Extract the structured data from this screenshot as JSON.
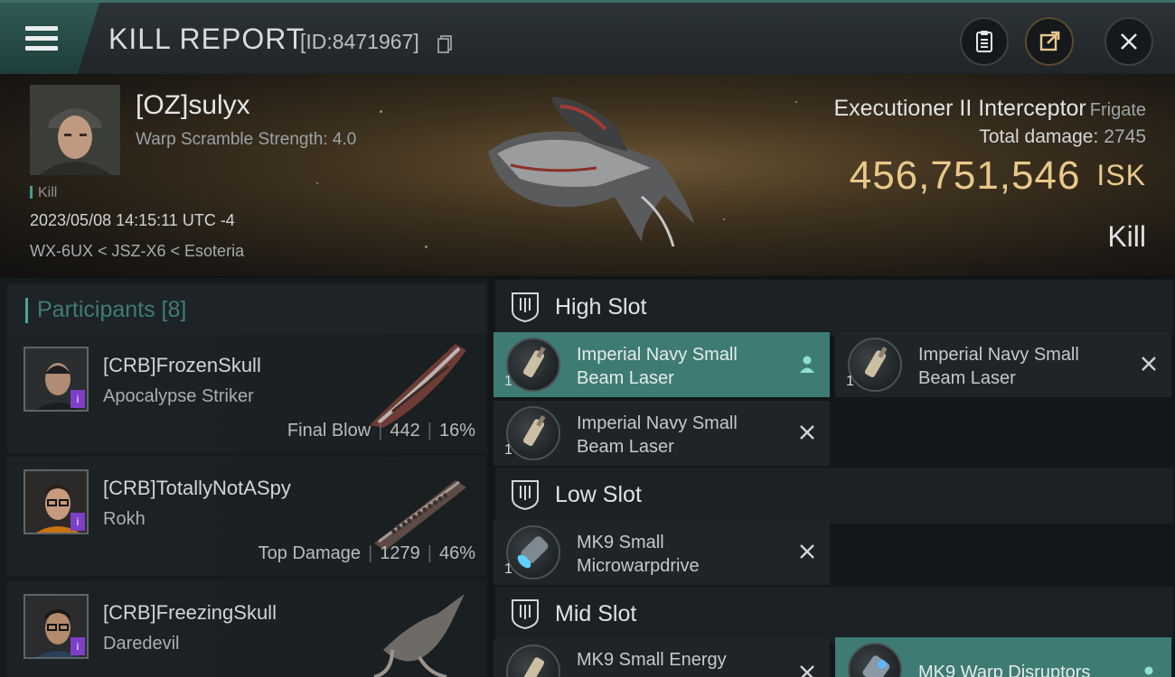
{
  "header": {
    "title": "KILL REPORT",
    "report_id": "[ID:8471967]"
  },
  "victim": {
    "name": "[OZ]sulyx",
    "subtitle": "Warp Scramble Strength: 4.0",
    "tag": "Kill",
    "datetime": "2023/05/08 14:15:11 UTC -4",
    "location": "WX-6UX < JSZ-X6 < Esoteria",
    "ship_name": "Executioner II Interceptor",
    "ship_class": "Frigate",
    "total_damage_label": "Total damage:",
    "total_damage": "2745",
    "isk_value": "456,751,546",
    "isk_unit": "ISK",
    "result": "Kill"
  },
  "participants": {
    "title": "Participants [8]",
    "rows": [
      {
        "name": "[CRB]FrozenSkull",
        "ship": "Apocalypse Striker",
        "label": "Final Blow",
        "damage": "442",
        "percent": "16%"
      },
      {
        "name": "[CRB]TotallyNotASpy",
        "ship": "Rokh",
        "label": "Top Damage",
        "damage": "1279",
        "percent": "46%"
      },
      {
        "name": "[CRB]FreezingSkull",
        "ship": "Daredevil",
        "label": "",
        "damage": "",
        "percent": ""
      }
    ]
  },
  "fitting": {
    "high_slot": "High Slot",
    "low_slot": "Low Slot",
    "mid_slot": "Mid Slot",
    "modules": {
      "h1": {
        "name": "Imperial Navy Small Beam Laser",
        "qty": "1"
      },
      "h2": {
        "name": "Imperial Navy Small Beam Laser",
        "qty": "1"
      },
      "h3": {
        "name": "Imperial Navy Small Beam Laser",
        "qty": "1"
      },
      "l1": {
        "name": "MK9 Small Microwarpdrive",
        "qty": "1"
      },
      "m1": {
        "name": "MK9 Small Energy",
        "qty": ""
      },
      "m2": {
        "name": "MK9 Warp Disruptors",
        "qty": ""
      }
    }
  },
  "colors": {
    "accent_teal": "#3e7b74",
    "isk_gold": "#e9c88a",
    "corp_purple": "#7d3fc7"
  }
}
